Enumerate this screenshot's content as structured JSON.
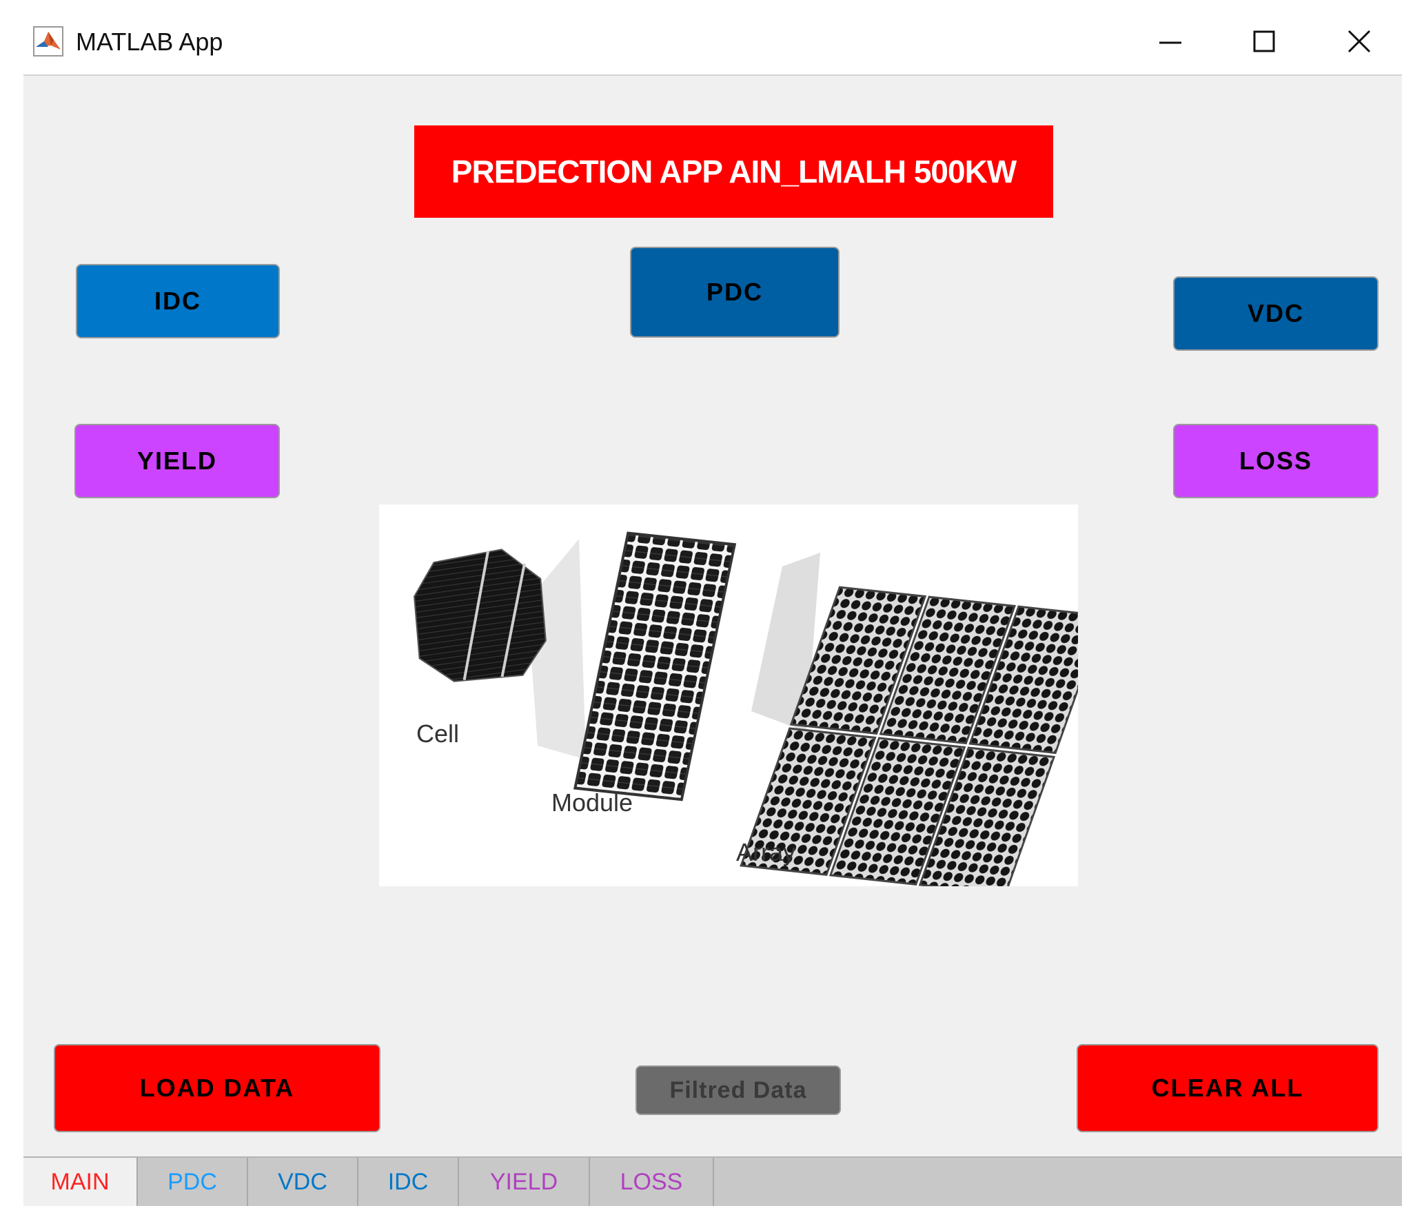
{
  "window": {
    "title": "MATLAB App",
    "controls": [
      "minimize",
      "maximize",
      "close"
    ]
  },
  "header": {
    "banner_text": "PREDECTION APP AIN_LMALH 500KW",
    "banner_color": "#ff0000"
  },
  "buttons": {
    "idc": "IDC",
    "pdc": "PDC",
    "vdc": "VDC",
    "yield": "YIELD",
    "loss": "LOSS",
    "load_data": "LOAD DATA",
    "filtred_data": "Filtred Data",
    "clear_all": "CLEAR ALL"
  },
  "image": {
    "labels": {
      "cell": "Cell",
      "module": "Module",
      "array": "Array"
    }
  },
  "tabs": [
    {
      "label": "MAIN",
      "color": "#ff2222",
      "active": true
    },
    {
      "label": "PDC",
      "color": "#1a9cff",
      "active": false
    },
    {
      "label": "VDC",
      "color": "#0077c8",
      "active": false
    },
    {
      "label": "IDC",
      "color": "#0077c8",
      "active": false
    },
    {
      "label": "YIELD",
      "color": "#b040c0",
      "active": false
    },
    {
      "label": "LOSS",
      "color": "#b040c0",
      "active": false
    }
  ],
  "colors": {
    "blue_button": "#0077c8",
    "dark_blue_button": "#005fa3",
    "purple_button": "#cc44ff",
    "red_button": "#ff0000",
    "gray_button": "#6b6b6b",
    "background": "#f0f0f0"
  }
}
